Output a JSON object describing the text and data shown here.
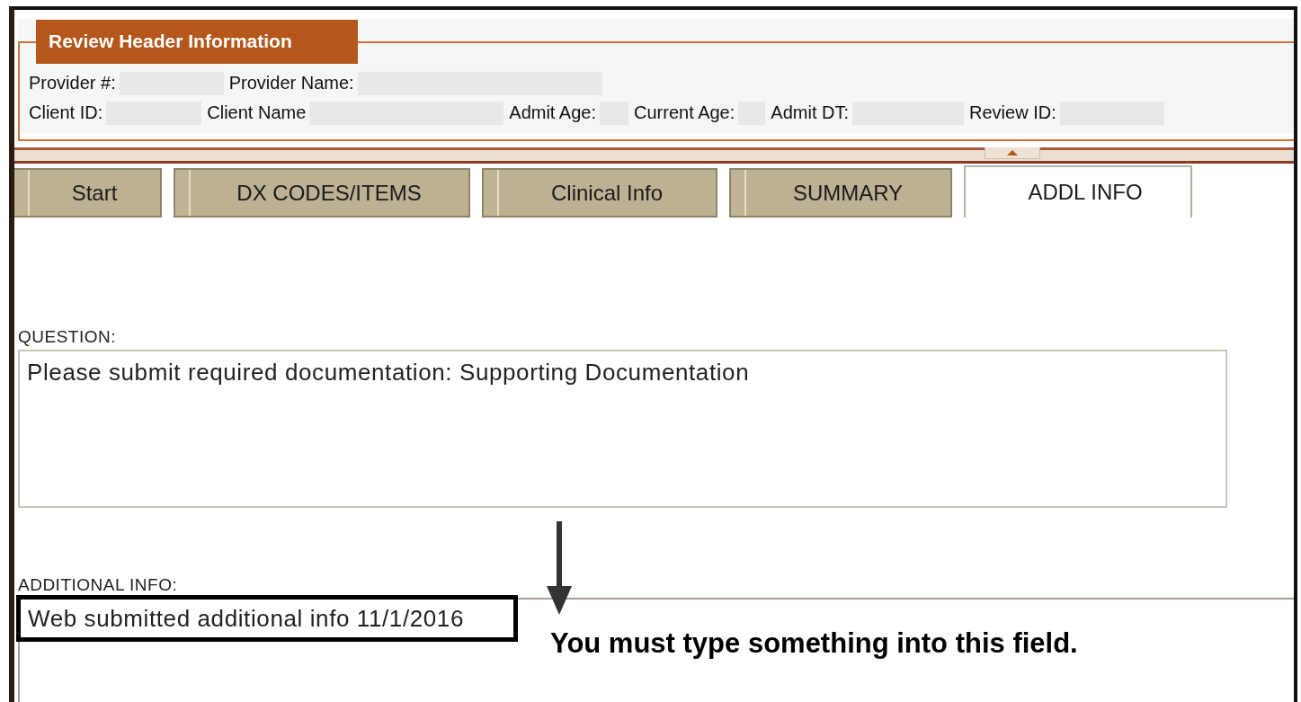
{
  "header": {
    "title": "Review Header Information",
    "rows": [
      [
        {
          "label": "Provider #:"
        },
        {
          "label": "Provider Name:"
        }
      ],
      [
        {
          "label": "Client ID:"
        },
        {
          "label": "Client Name"
        },
        {
          "label": "Admit Age:"
        },
        {
          "label": "Current Age:"
        },
        {
          "label": "Admit DT:"
        },
        {
          "label": "Review ID:"
        }
      ]
    ]
  },
  "tabs": [
    {
      "label": "Start",
      "selected": false
    },
    {
      "label": "DX CODES/ITEMS",
      "selected": false
    },
    {
      "label": "Clinical Info",
      "selected": false
    },
    {
      "label": "SUMMARY",
      "selected": false
    },
    {
      "label": "ADDL INFO",
      "selected": true
    }
  ],
  "question": {
    "label": "QUESTION:",
    "value": "Please submit required documentation: Supporting Documentation"
  },
  "additional_info": {
    "label": "ADDITIONAL INFO:",
    "value": "Web submitted additional info 11/1/2016"
  },
  "annotation": {
    "text": "You must type something into this field."
  }
}
